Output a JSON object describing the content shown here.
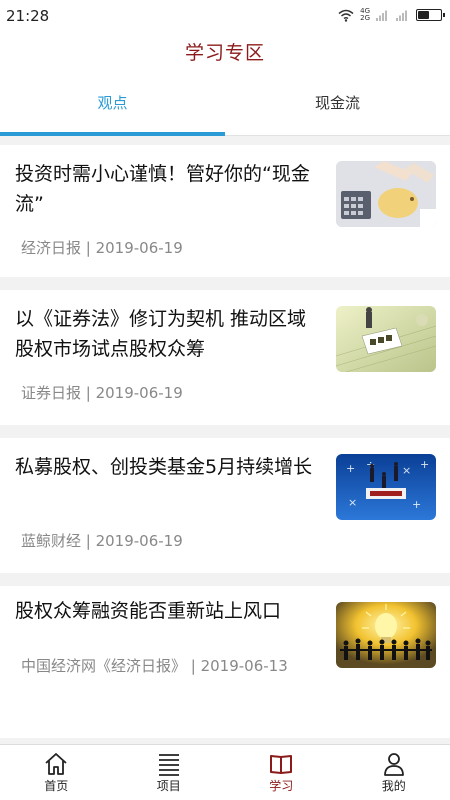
{
  "status_bar": {
    "time": "21:28",
    "net_top": "4G",
    "net_bottom": "2G",
    "battery_level": 0.45
  },
  "header": {
    "title": "学习专区"
  },
  "tabs": [
    {
      "label": "观点",
      "active": true
    },
    {
      "label": "现金流",
      "active": false
    }
  ],
  "articles": [
    {
      "title": "投资时需小心谨慎！管好你的“现金流”",
      "meta": "经济日报 | 2019-06-19",
      "thumb_icon": "piggy-bank-calculator-icon"
    },
    {
      "title": "以《证券法》修订为契机 推动区域股权市场试点股权众筹",
      "meta": "证券日报 | 2019-06-19",
      "thumb_icon": "securities-law-icon"
    },
    {
      "title": "私募股权、创投类基金5月持续增长",
      "meta": "蓝鲸财经 | 2019-06-19",
      "thumb_icon": "private-fund-icon"
    },
    {
      "title": "股权众筹融资能否重新站上风口",
      "meta": "中国经济网《经济日报》 | 2019-06-13",
      "thumb_icon": "crowdfunding-lightbulb-icon"
    }
  ],
  "bottom_nav": [
    {
      "label": "首页",
      "icon": "home-icon"
    },
    {
      "label": "项目",
      "icon": "list-icon"
    },
    {
      "label": "学习",
      "icon": "book-icon",
      "active": true
    },
    {
      "label": "我的",
      "icon": "user-icon"
    }
  ],
  "colors": {
    "accent": "#2a9bd4",
    "brand": "#8b1a1a"
  }
}
